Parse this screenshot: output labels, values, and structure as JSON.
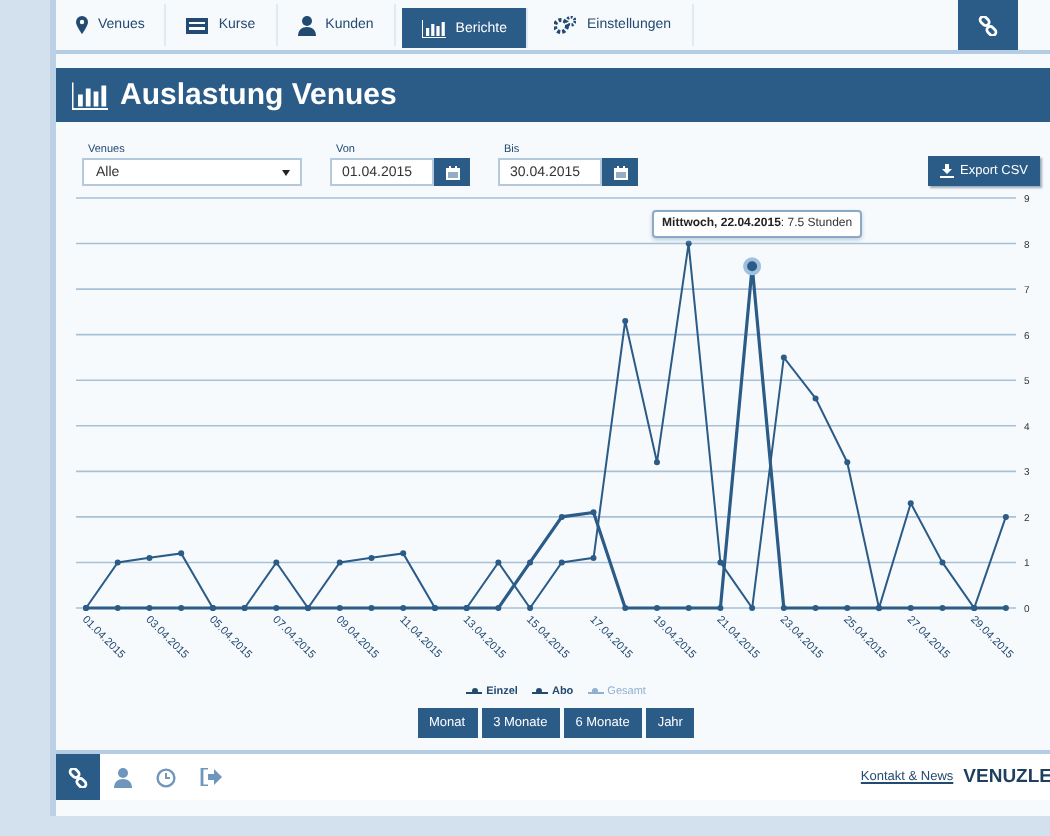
{
  "nav": {
    "tabs": [
      {
        "label": "Venues",
        "selected": false
      },
      {
        "label": "Kurse",
        "selected": false
      },
      {
        "label": "Kunden",
        "selected": false
      },
      {
        "label": "Berichte",
        "selected": true
      },
      {
        "label": "Einstellungen",
        "selected": false
      }
    ]
  },
  "header": {
    "title": "Auslastung Venues"
  },
  "filters": {
    "venues": {
      "label": "Venues",
      "value": "Alle"
    },
    "from": {
      "label": "Von",
      "value": "01.04.2015"
    },
    "to": {
      "label": "Bis",
      "value": "30.04.2015"
    },
    "export_button": "Export CSV"
  },
  "chart": {
    "chart_data": {
      "type": "line",
      "categories": [
        "01.04.2015",
        null,
        "03.04.2015",
        null,
        "05.04.2015",
        null,
        "07.04.2015",
        null,
        "09.04.2015",
        null,
        "11.04.2015",
        null,
        "13.04.2015",
        null,
        "15.04.2015",
        null,
        "17.04.2015",
        null,
        "19.04.2015",
        null,
        "21.04.2015",
        null,
        "23.04.2015",
        null,
        "25.04.2015",
        null,
        "27.04.2015",
        null,
        "29.04.2015",
        null
      ],
      "series": [
        {
          "name": "Einzel",
          "color": "#2b5b87",
          "marker": "circle",
          "values": [
            0,
            1,
            1.1,
            1.2,
            0,
            0,
            1,
            0,
            1,
            1.1,
            1.2,
            0,
            0,
            1,
            0,
            1,
            1.1,
            6.3,
            3.2,
            8,
            1,
            0,
            5.5,
            4.6,
            3.2,
            0,
            2.3,
            1,
            0,
            2
          ]
        },
        {
          "name": "Abo",
          "color": "#2b5b87",
          "marker": "circle",
          "values": [
            0,
            0,
            0,
            0,
            0,
            0,
            0,
            0,
            0,
            0,
            0,
            0,
            0,
            0,
            1,
            2,
            2.1,
            0,
            0,
            0,
            0,
            7.5,
            0,
            0,
            0,
            0,
            0,
            0,
            0,
            0
          ]
        },
        {
          "name": "Gesamt",
          "color": "#8fb0d0",
          "values": [
            null,
            null,
            null,
            null,
            null,
            null,
            null,
            null,
            null,
            null,
            null,
            null,
            null,
            null,
            null,
            null,
            null,
            null,
            null,
            null,
            null,
            null,
            null,
            null,
            null,
            null,
            null,
            null,
            null,
            null
          ]
        }
      ],
      "ylim": [
        0,
        9
      ],
      "yticks": [
        0,
        1,
        2,
        3,
        4,
        5,
        6,
        7,
        8,
        9
      ],
      "grid": true
    },
    "tooltip": {
      "text": "**Mittwoch, 22.04.2015**: 7.5 Stunden"
    },
    "legend": [
      {
        "hidden": false
      },
      {
        "hidden": false
      },
      {
        "hidden": true
      }
    ],
    "range_buttons": [
      {
        "label": "Monat",
        "selected": false
      },
      {
        "label": "3 Monate",
        "selected": false
      },
      {
        "label": "6 Monate",
        "selected": false
      },
      {
        "label": "Jahr",
        "selected": false
      }
    ]
  },
  "footer": {
    "items": [
      {
        "selected": true
      },
      {
        "selected": false
      },
      {
        "selected": false
      },
      {
        "selected": false
      }
    ],
    "link": "Kontakt & News",
    "brand": "VENUZLE"
  }
}
